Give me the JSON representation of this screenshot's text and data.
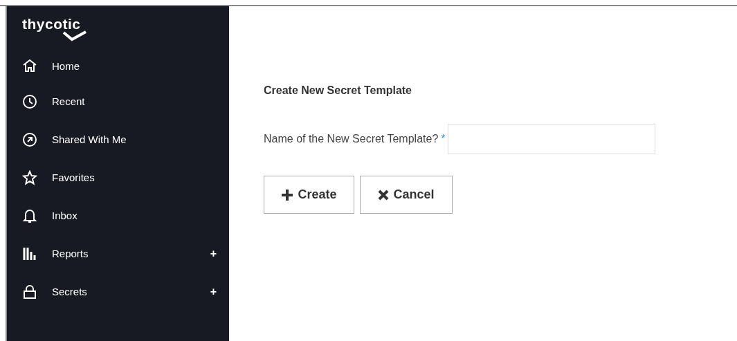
{
  "sidebar": {
    "logo": "thycotic",
    "items": [
      {
        "label": "Home"
      },
      {
        "label": "Recent"
      },
      {
        "label": "Shared With Me"
      },
      {
        "label": "Favorites"
      },
      {
        "label": "Inbox"
      },
      {
        "label": "Reports",
        "expander": "+"
      },
      {
        "label": "Secrets",
        "expander": "+"
      }
    ]
  },
  "form": {
    "title": "Create New Secret Template",
    "field_label": "Name of the New Secret Template?",
    "required_mark": "*",
    "buttons": [
      {
        "kind": "create",
        "label": "Create"
      },
      {
        "kind": "cancel",
        "label": "Cancel"
      }
    ]
  }
}
